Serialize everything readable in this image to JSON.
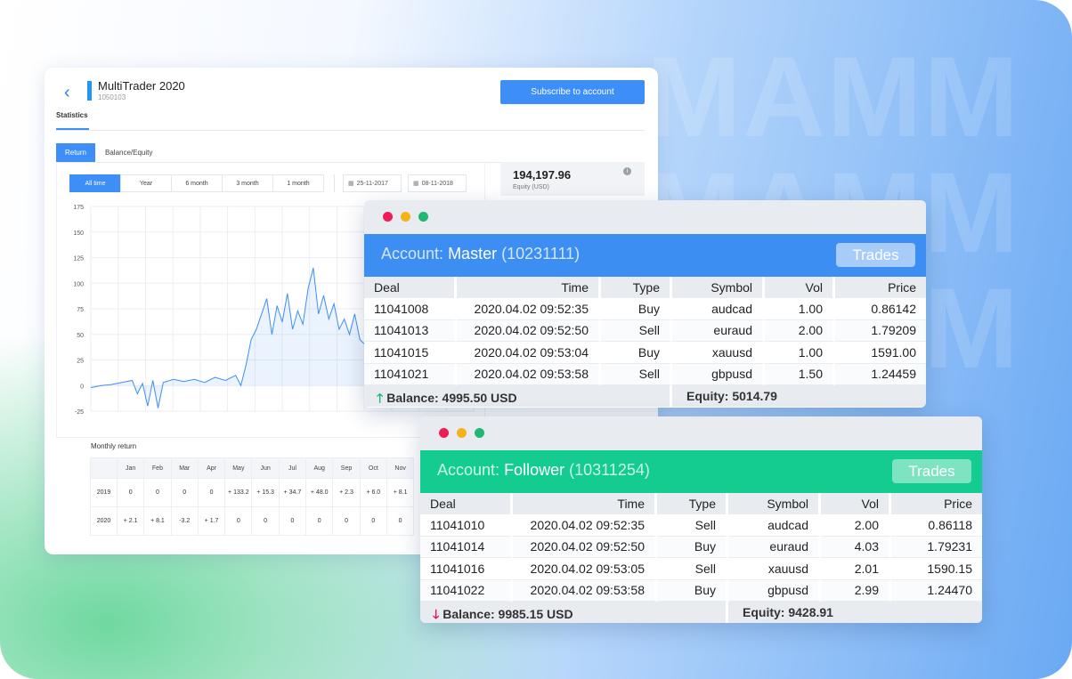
{
  "watermark": [
    "MAMM",
    "MAMM",
    "MAMM"
  ],
  "stats": {
    "account_name": "MultiTrader 2020",
    "account_id": "1050103",
    "subscribe_label": "Subscribe to account",
    "section_tab": "Statistics",
    "view_tabs": [
      "Return",
      "Balance/Equity"
    ],
    "ranges": [
      "All time",
      "Year",
      "6 month",
      "3 month",
      "1 month"
    ],
    "date_from": "25-11-2017",
    "date_to": "08-11-2018",
    "equity_value": "194,197.96",
    "equity_label": "Equity (USD)",
    "info_glyph": "i",
    "back_glyph": "‹",
    "calendar_glyph": "▦",
    "monthly_title": "Monthly return",
    "months": [
      "Jan",
      "Feb",
      "Mar",
      "Apr",
      "May",
      "Jun",
      "Jul",
      "Aug",
      "Sep",
      "Oct",
      "Nov"
    ],
    "rows": [
      {
        "year": "2019",
        "values": [
          "0",
          "0",
          "0",
          "0",
          "+ 133.2",
          "+ 15.3",
          "+ 34.7",
          "+ 48.0",
          "+ 2.3",
          "+ 6.0",
          "+ 8.1"
        ]
      },
      {
        "year": "2020",
        "values": [
          "+ 2.1",
          "+ 8.1",
          "-3.2",
          "+ 1.7",
          "0",
          "0",
          "0",
          "0",
          "0",
          "0",
          "0"
        ]
      }
    ]
  },
  "chart_data": {
    "type": "area",
    "yticks": [
      "175",
      "150",
      "125",
      "100",
      "75",
      "50",
      "25",
      "0",
      "-25"
    ],
    "ylim": [
      -25,
      175
    ],
    "color": "#3d8ef7",
    "x": [
      0,
      2,
      4,
      6,
      8,
      9,
      10,
      11,
      12,
      13,
      14,
      16,
      18,
      20,
      22,
      24,
      26,
      28,
      29,
      30,
      31,
      32,
      33,
      34,
      35,
      36,
      37,
      38,
      39,
      40,
      41,
      42,
      43,
      44,
      45,
      46,
      47,
      48,
      49,
      50,
      51,
      52,
      53,
      54,
      55,
      56,
      57,
      58,
      59,
      60,
      61,
      62,
      63,
      64,
      65,
      66,
      67,
      68,
      70,
      72,
      73,
      74
    ],
    "y": [
      -2,
      0,
      1,
      3,
      5,
      -8,
      2,
      -20,
      5,
      -22,
      3,
      6,
      4,
      6,
      3,
      8,
      5,
      10,
      0,
      20,
      45,
      55,
      70,
      85,
      50,
      78,
      62,
      90,
      55,
      73,
      60,
      95,
      115,
      70,
      88,
      65,
      80,
      55,
      65,
      50,
      70,
      45,
      40,
      60,
      55,
      85,
      50,
      70,
      90,
      45,
      75,
      15,
      40,
      85,
      60,
      70,
      90,
      65,
      78,
      95,
      80,
      90
    ]
  },
  "master": {
    "title_label": "Account:",
    "title_role": "Master",
    "title_id": "(10231111)",
    "trades_label": "Trades",
    "headers": [
      "Deal",
      "Time",
      "Type",
      "Symbol",
      "Vol",
      "Price"
    ],
    "rows": [
      [
        "11041008",
        "2020.04.02 09:52:35",
        "Buy",
        "audcad",
        "1.00",
        "0.86142"
      ],
      [
        "11041013",
        "2020.04.02 09:52:50",
        "Sell",
        "euraud",
        "2.00",
        "1.79209"
      ],
      [
        "11041015",
        "2020.04.02 09:53:04",
        "Buy",
        "xauusd",
        "1.00",
        "1591.00"
      ],
      [
        "11041021",
        "2020.04.02 09:53:58",
        "Sell",
        "gbpusd",
        "1.50",
        "1.24459"
      ]
    ],
    "balance": "Balance: 4995.50 USD",
    "equity": "Equity: 5014.79",
    "balance_arrow": "🡑"
  },
  "follower": {
    "title_label": "Account:",
    "title_role": "Follower",
    "title_id": "(10311254)",
    "trades_label": "Trades",
    "headers": [
      "Deal",
      "Time",
      "Type",
      "Symbol",
      "Vol",
      "Price"
    ],
    "rows": [
      [
        "11041010",
        "2020.04.02 09:52:35",
        "Sell",
        "audcad",
        "2.00",
        "0.86118"
      ],
      [
        "11041014",
        "2020.04.02 09:52:50",
        "Buy",
        "euraud",
        "4.03",
        "1.79231"
      ],
      [
        "11041016",
        "2020.04.02 09:53:05",
        "Sell",
        "xauusd",
        "2.01",
        "1590.15"
      ],
      [
        "11041022",
        "2020.04.02 09:53:58",
        "Buy",
        "gbpusd",
        "2.99",
        "1.24470"
      ]
    ],
    "balance": "Balance: 9985.15 USD",
    "equity": "Equity: 9428.91",
    "balance_arrow": "🡓"
  }
}
